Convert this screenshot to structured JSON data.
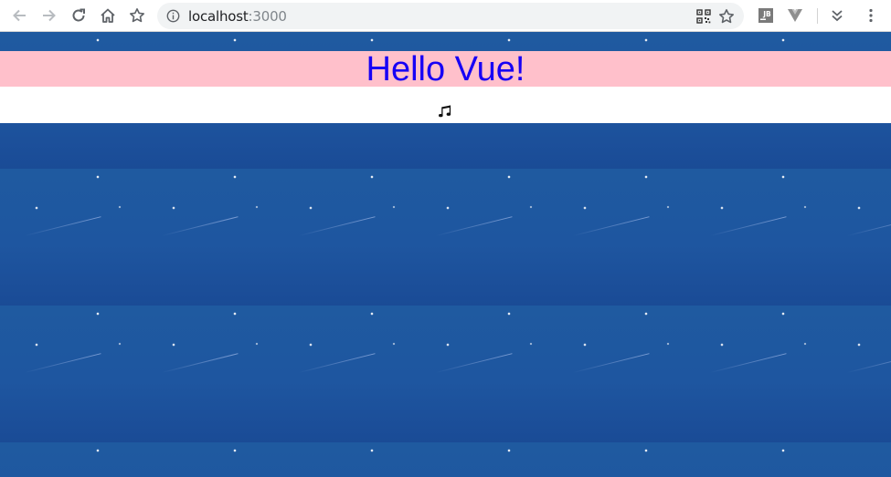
{
  "browser": {
    "url_host": "localhost",
    "url_port": ":3000",
    "icons": {
      "back": "back-arrow-icon",
      "forward": "forward-arrow-icon",
      "reload": "reload-icon",
      "home": "home-icon",
      "bookmark": "star-icon",
      "site_info": "info-icon",
      "qr": "qr-code-icon",
      "bookmark_page": "star-icon",
      "extension_1": "jb-extension-icon",
      "extension_2": "vue-devtools-icon",
      "extensions_menu": "chevron-double-icon",
      "menu": "kebab-menu-icon"
    }
  },
  "page": {
    "title": "Hello Vue!",
    "music_icon": "music-note-icon",
    "colors": {
      "background": "#20549c",
      "header_band": "#ffc0cb",
      "title_text": "#1700f5",
      "white_band": "#ffffff"
    }
  }
}
